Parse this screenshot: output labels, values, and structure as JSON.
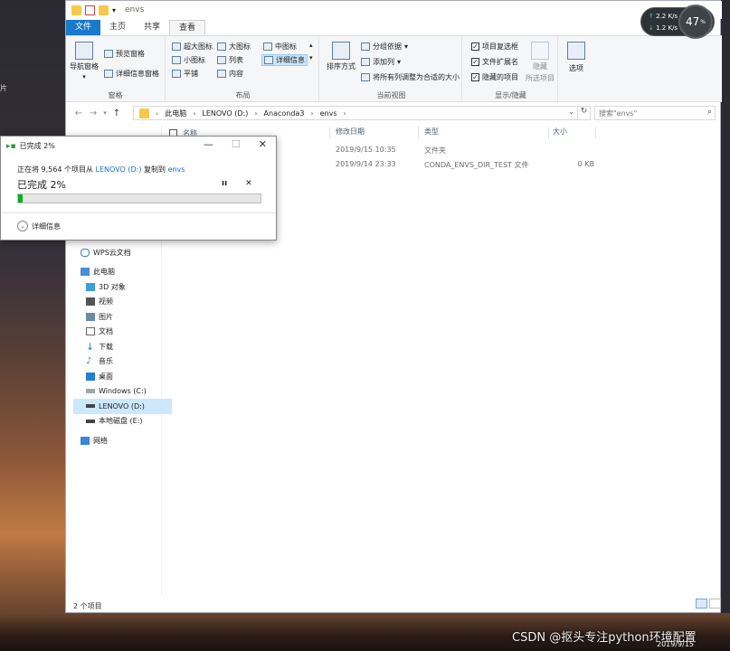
{
  "desktop": {
    "side_text": "片",
    "watermark": "CSDN @抠头专注python环境配置",
    "datestamp": "2019/9/15"
  },
  "window": {
    "title": "envs"
  },
  "ribbon": {
    "tabs": [
      "文件",
      "主页",
      "共享",
      "查看"
    ],
    "pane_group": {
      "label": "窗格",
      "nav_pane": "导航窗格",
      "preview": "预览窗格",
      "details": "详细信息窗格"
    },
    "layout_group": {
      "label": "布局",
      "items": [
        "超大图标",
        "大图标",
        "中图标",
        "小图标",
        "列表",
        "详细信息",
        "平铺",
        "内容"
      ]
    },
    "view_group": {
      "label": "当前视图",
      "sort": "排序方式",
      "group_by": "分组依据",
      "add_col": "添加列",
      "fit_cols": "将所有列调整为合适的大小"
    },
    "showhide_group": {
      "label": "显示/隐藏",
      "item_checkbox": "项目复选框",
      "file_ext": "文件扩展名",
      "hidden_items": "隐藏的项目",
      "hide": "隐藏",
      "selected": "所选项目"
    },
    "options": "选项"
  },
  "address": {
    "crumbs": [
      "此电脑",
      "LENOVO (D:)",
      "Anaconda3",
      "envs"
    ],
    "search_placeholder": "搜索\"envs\""
  },
  "columns": {
    "name": "名称",
    "modified": "修改日期",
    "type": "类型",
    "size": "大小"
  },
  "files": [
    {
      "modified": "2019/9/15 10:35",
      "type": "文件夹",
      "size": ""
    },
    {
      "modified": "2019/9/14 23:33",
      "type": "CONDA_ENVS_DIR_TEST 文件",
      "size": "0 KB"
    }
  ],
  "nav": {
    "items": [
      {
        "label": "WPS云文档",
        "icon": "cloud-icon"
      },
      {
        "label": "此电脑",
        "icon": "computer-icon"
      },
      {
        "label": "3D 对象",
        "icon": "cube-icon"
      },
      {
        "label": "视频",
        "icon": "video-icon"
      },
      {
        "label": "图片",
        "icon": "picture-icon"
      },
      {
        "label": "文档",
        "icon": "document-icon"
      },
      {
        "label": "下载",
        "icon": "download-icon"
      },
      {
        "label": "音乐",
        "icon": "music-icon"
      },
      {
        "label": "桌面",
        "icon": "desktop-icon"
      },
      {
        "label": "Windows (C:)",
        "icon": "drive-icon"
      },
      {
        "label": "LENOVO (D:)",
        "icon": "drive-icon"
      },
      {
        "label": "本地磁盘 (E:)",
        "icon": "drive-icon"
      },
      {
        "label": "网络",
        "icon": "network-icon"
      }
    ]
  },
  "status": {
    "count": "2 个项目"
  },
  "copy_dialog": {
    "title": "已完成 2%",
    "line_prefix": "正在将 9,564 个项目从",
    "source": "LENOVO (D:)",
    "mid": "复制到",
    "dest": "envs",
    "percent_text": "已完成 2%",
    "progress": 0.02,
    "more": "详细信息"
  },
  "netwidget": {
    "up": "2.2",
    "down": "1.2",
    "unit": "K/s",
    "cpu": "47",
    "cpu_unit": "%"
  }
}
